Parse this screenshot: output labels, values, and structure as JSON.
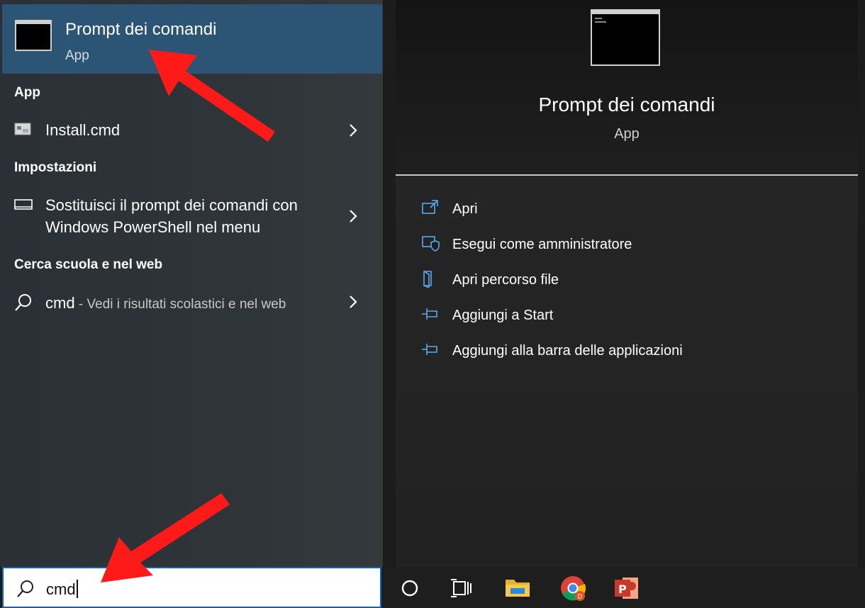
{
  "best_match": {
    "title": "Prompt dei comandi",
    "subtitle": "App"
  },
  "sections": {
    "app": {
      "header": "App",
      "item": {
        "label": "Install.cmd"
      }
    },
    "settings": {
      "header": "Impostazioni",
      "item": {
        "line1": "Sostituisci il prompt dei comandi con",
        "line2": "Windows PowerShell nel menu"
      }
    },
    "web": {
      "header": "Cerca scuola e nel web",
      "item": {
        "query": "cmd",
        "suffix": " - Vedi i risultati scolastici e nel web"
      }
    }
  },
  "search": {
    "value": "cmd"
  },
  "preview": {
    "title": "Prompt dei comandi",
    "subtitle": "App",
    "actions": [
      {
        "label": "Apri",
        "icon": "open-icon"
      },
      {
        "label": "Esegui come amministratore",
        "icon": "shield-icon"
      },
      {
        "label": "Apri percorso file",
        "icon": "folder-icon"
      },
      {
        "label": "Aggiungi a Start",
        "icon": "pin-icon"
      },
      {
        "label": "Aggiungi alla barra delle applicazioni",
        "icon": "pin-icon"
      }
    ]
  },
  "taskbar": {
    "icons": [
      "cortana-icon",
      "task-view-icon",
      "file-explorer-icon",
      "chrome-icon",
      "powerpoint-icon"
    ]
  },
  "colors": {
    "accent": "#2b5475",
    "search_border": "#0a63c9",
    "arrow": "#ff1a1a"
  }
}
